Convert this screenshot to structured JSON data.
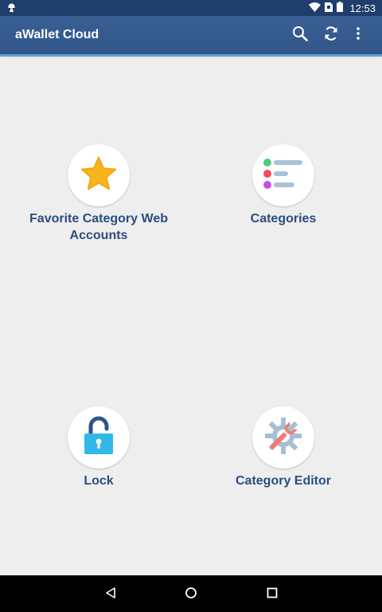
{
  "status_bar": {
    "time": "12:53"
  },
  "app_bar": {
    "title": "aWallet Cloud",
    "actions": [
      "search-icon",
      "sync-icon",
      "overflow-menu-icon"
    ]
  },
  "tiles": [
    {
      "label": "Favorite Category Web Accounts",
      "icon": "star-icon"
    },
    {
      "label": "Categories",
      "icon": "category-list-icon"
    },
    {
      "label": "Lock",
      "icon": "unlocked-padlock-icon"
    },
    {
      "label": "Category Editor",
      "icon": "gear-wrench-icon"
    }
  ],
  "nav_bar": {
    "buttons": [
      "back-icon",
      "home-icon",
      "recents-icon"
    ]
  },
  "colors": {
    "status_bar": "#1f3e6b",
    "app_bar": "#30568a",
    "accent_line": "#5aa0d8",
    "background": "#eeeeee",
    "label": "#2b4d80"
  }
}
